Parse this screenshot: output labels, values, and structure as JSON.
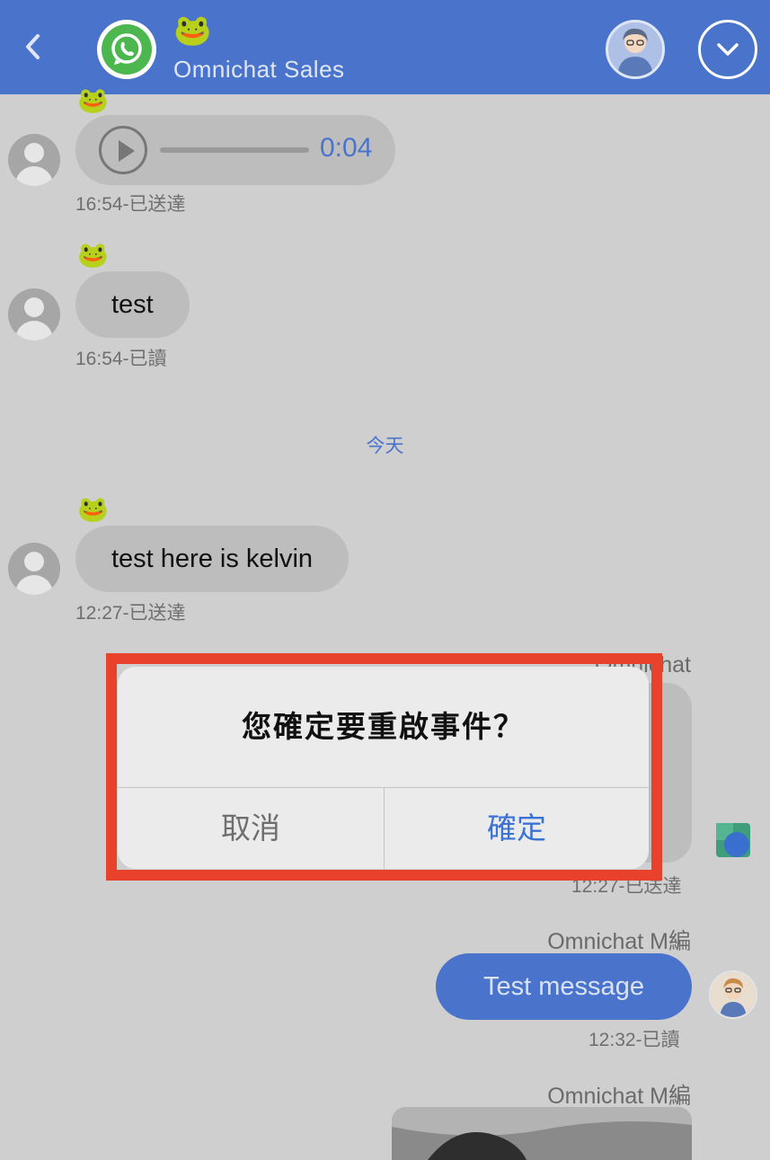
{
  "header": {
    "emoji": "🐸",
    "title": "Omnichat Sales"
  },
  "messages": {
    "m1": {
      "emoji": "🐸",
      "audio_duration": "0:04",
      "meta": "16:54-已送達"
    },
    "m2": {
      "emoji": "🐸",
      "text": "test",
      "meta": "16:54-已讀"
    },
    "date_separator": "今天",
    "m3": {
      "emoji": "🐸",
      "text": "test here is kelvin",
      "meta": "12:27-已送達"
    },
    "m4": {
      "sender": "Omnichat",
      "meta": "12:27-已送達"
    },
    "m5": {
      "sender": "Omnichat M編",
      "text": "Test message",
      "meta": "12:32-已讀"
    },
    "m6": {
      "sender": "Omnichat M編"
    }
  },
  "dialog": {
    "title": "您確定要重啟事件？",
    "cancel_label": "取消",
    "confirm_label": "確定"
  },
  "colors": {
    "header_bg": "#4a74cc",
    "highlight": "#e8412c",
    "whatsapp_green": "#4bb74e",
    "confirm_text": "#3a73d4"
  }
}
